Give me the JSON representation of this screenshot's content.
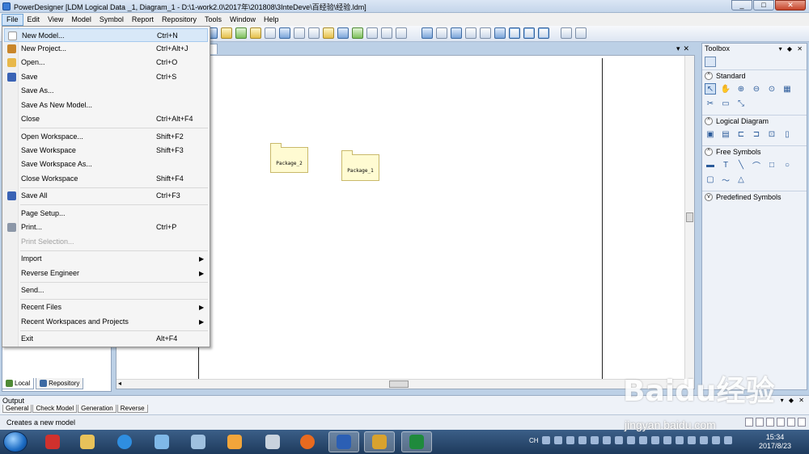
{
  "window": {
    "title": "PowerDesigner [LDM Logical Data _1, Diagram_1 - D:\\1-work2.0\\2017年\\201808\\3InteDeve\\百经验\\经验.ldm]",
    "minimize": "_",
    "maximize": "□",
    "close": "✕"
  },
  "menubar": [
    "File",
    "Edit",
    "View",
    "Model",
    "Symbol",
    "Report",
    "Repository",
    "Tools",
    "Window",
    "Help"
  ],
  "file_menu": [
    {
      "label": "New Model...",
      "shortcut": "Ctrl+N",
      "icon": "new-model-icon",
      "color": "#ffffff"
    },
    {
      "label": "New Project...",
      "shortcut": "Ctrl+Alt+J",
      "icon": "new-project-icon",
      "color": "#c9862a"
    },
    {
      "label": "Open...",
      "shortcut": "Ctrl+O",
      "icon": "open-folder-icon",
      "color": "#e8b84a"
    },
    {
      "label": "Save",
      "shortcut": "Ctrl+S",
      "icon": "save-icon",
      "color": "#3a63b5"
    },
    {
      "label": "Save As...",
      "shortcut": ""
    },
    {
      "label": "Save As New Model...",
      "shortcut": ""
    },
    {
      "label": "Close",
      "shortcut": "Ctrl+Alt+F4"
    },
    {
      "label": "Open Workspace...",
      "shortcut": "Shift+F2"
    },
    {
      "label": "Save Workspace",
      "shortcut": "Shift+F3"
    },
    {
      "label": "Save Workspace As...",
      "shortcut": ""
    },
    {
      "label": "Close Workspace",
      "shortcut": "Shift+F4"
    },
    {
      "label": "Save All",
      "shortcut": "Ctrl+F3",
      "icon": "save-all-icon",
      "color": "#3a63b5"
    },
    {
      "label": "Page Setup...",
      "shortcut": ""
    },
    {
      "label": "Print...",
      "shortcut": "Ctrl+P",
      "icon": "printer-icon",
      "color": "#8c97a8"
    },
    {
      "label": "Print Selection...",
      "shortcut": "",
      "disabled": true
    },
    {
      "label": "Import",
      "submenu": true
    },
    {
      "label": "Reverse Engineer",
      "submenu": true
    },
    {
      "label": "Send...",
      "shortcut": ""
    },
    {
      "label": "Recent Files",
      "submenu": true
    },
    {
      "label": "Recent Workspaces and Projects",
      "submenu": true
    },
    {
      "label": "Exit",
      "shortcut": "Alt+F4"
    }
  ],
  "diagram": {
    "tab_label": "st",
    "packages": [
      "Package_2",
      "Package_1"
    ]
  },
  "browser_tabs": [
    "Local",
    "Repository"
  ],
  "toolbox": {
    "title": "Toolbox",
    "sections": [
      "Standard",
      "Logical Diagram",
      "Free Symbols",
      "Predefined Symbols"
    ]
  },
  "output": {
    "title": "Output",
    "tabs": [
      "General",
      "Check Model",
      "Generation",
      "Reverse"
    ]
  },
  "status": "Creates a new model",
  "taskbar": {
    "lang": "CH",
    "time": "15:34",
    "date": "2017/8/23"
  },
  "watermark": {
    "brand": "Baidu经验",
    "url": "jingyan.baidu.com"
  }
}
